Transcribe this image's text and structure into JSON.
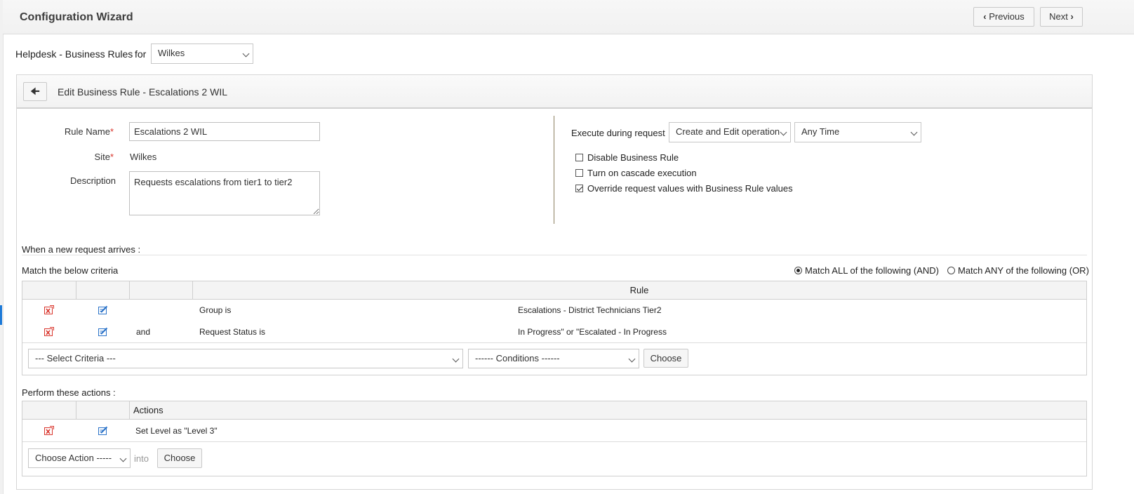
{
  "header": {
    "title": "Configuration Wizard",
    "previous_label": "Previous",
    "next_label": "Next"
  },
  "module": {
    "label": "Helpdesk - Business Rules",
    "for_label": "for",
    "site_value": "Wilkes"
  },
  "edit": {
    "title": "Edit Business Rule - Escalations 2 WIL"
  },
  "form": {
    "rule_name_label": "Rule Name",
    "rule_name_value": "Escalations 2 WIL",
    "site_label": "Site",
    "site_value": "Wilkes",
    "description_label": "Description",
    "description_value": "Requests escalations from tier1 to tier2",
    "required_mark": "*"
  },
  "execution": {
    "label": "Execute during request",
    "operation_value": "Create and Edit operation",
    "time_value": "Any Time",
    "options": [
      {
        "label": "Disable Business Rule",
        "checked": false
      },
      {
        "label": "Turn on cascade execution",
        "checked": false
      },
      {
        "label": "Override request values with Business Rule values",
        "checked": true
      }
    ]
  },
  "criteria": {
    "arrives_label": "When a new request arrives :",
    "match_label": "Match the below criteria",
    "match_all_label": "Match ALL of the following (AND)",
    "match_any_label": "Match ANY of the following (OR)",
    "selected_match": "all",
    "rule_header": "Rule",
    "rows": [
      {
        "conj": "",
        "field": "Group is",
        "value": "Escalations - District Technicians Tier2"
      },
      {
        "conj": "and",
        "field": "Request Status is",
        "value": "In Progress\" or \"Escalated - In Progress"
      }
    ],
    "select_criteria_value": "--- Select Criteria ---",
    "conditions_value": "------ Conditions ------",
    "choose_label": "Choose"
  },
  "actions": {
    "perform_label": "Perform these actions :",
    "actions_header": "Actions",
    "rows": [
      {
        "text": "Set Level as \"Level 3\""
      }
    ],
    "choose_action_value": "Choose Action -----",
    "into_label": "into",
    "choose_label": "Choose"
  },
  "colors": {
    "delete_icon": "#d9342b",
    "edit_icon": "#2b73c9",
    "divider": "#8a7d5e"
  }
}
